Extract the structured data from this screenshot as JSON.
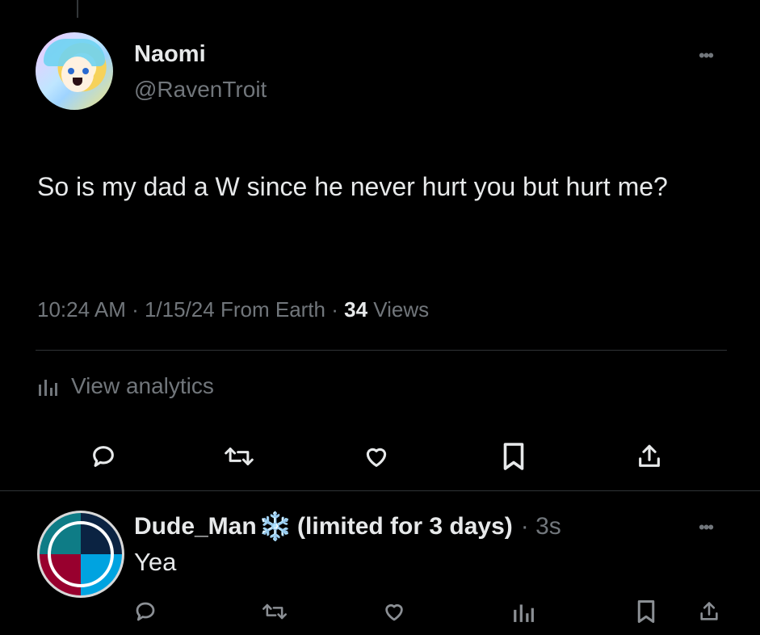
{
  "tweet": {
    "display_name": "Naomi",
    "handle": "@RavenTroit",
    "more_icon": "ellipsis-icon",
    "text": "So is my dad a W since he never hurt you but hurt me?",
    "time": "10:24 AM",
    "date": "1/15/24",
    "source": "From Earth",
    "views_count": "34",
    "views_label": "Views",
    "analytics_label": "View analytics",
    "actions": [
      "reply-icon",
      "retweet-icon",
      "like-icon",
      "bookmark-icon",
      "share-icon"
    ]
  },
  "reply": {
    "display_name": "Dude_Man",
    "emoji": "❄️",
    "limited_note": "(limited for 3 days)",
    "time": "3s",
    "text": "Yea",
    "actions": [
      "reply-icon",
      "retweet-icon",
      "like-icon",
      "views-icon",
      "bookmark-icon",
      "share-icon"
    ]
  },
  "colors": {
    "background": "#000000",
    "primary_text": "#e7e9ea",
    "secondary_text": "#71767b",
    "divider": "#2f3336",
    "snowflake": "#2b9ee8"
  }
}
